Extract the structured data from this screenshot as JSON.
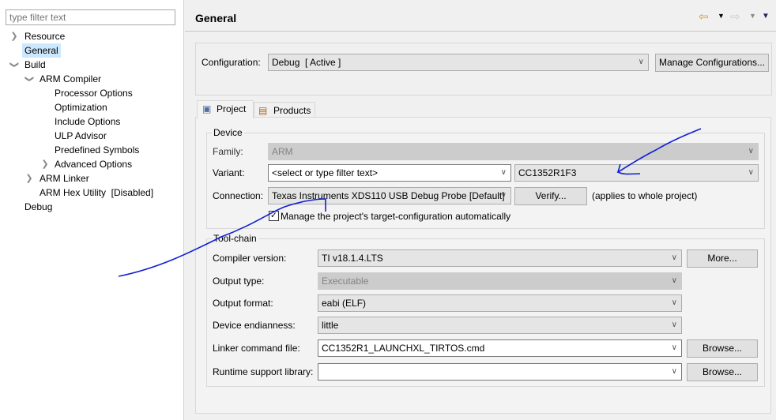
{
  "sidebar": {
    "filter_placeholder": "type filter text",
    "items": [
      {
        "label": "Resource"
      },
      {
        "label": "General"
      },
      {
        "label": "Build"
      },
      {
        "label": "ARM Compiler"
      },
      {
        "label": "Processor Options"
      },
      {
        "label": "Optimization"
      },
      {
        "label": "Include Options"
      },
      {
        "label": "ULP Advisor"
      },
      {
        "label": "Predefined Symbols"
      },
      {
        "label": "Advanced Options"
      },
      {
        "label": "ARM Linker"
      },
      {
        "label": "ARM Hex Utility  [Disabled]"
      },
      {
        "label": "Debug"
      }
    ]
  },
  "header": {
    "title": "General"
  },
  "config": {
    "label": "Configuration:",
    "value": "Debug  [ Active ]",
    "manage": "Manage Configurations..."
  },
  "tabs": [
    {
      "label": "Project"
    },
    {
      "label": "Products"
    }
  ],
  "device": {
    "title": "Device",
    "family_label": "Family:",
    "family": "ARM",
    "variant_label": "Variant:",
    "variant_filter": "<select or type filter text>",
    "variant": "CC1352R1F3",
    "connection_label": "Connection:",
    "connection": "Texas Instruments XDS110 USB Debug Probe [Default]",
    "verify": "Verify...",
    "applies": "(applies to whole project)",
    "manage_label": "Manage the project's target-configuration automatically",
    "manage_checked": true
  },
  "toolchain": {
    "title": "Tool-chain",
    "compiler_label": "Compiler version:",
    "compiler": "TI v18.1.4.LTS",
    "more": "More...",
    "output_type_label": "Output type:",
    "output_type": "Executable",
    "output_format_label": "Output format:",
    "output_format": "eabi (ELF)",
    "endian_label": "Device endianness:",
    "endian": "little",
    "linker_label": "Linker command file:",
    "linker": "CC1352R1_LAUNCHXL_TIRTOS.cmd",
    "browse": "Browse...",
    "runtime_label": "Runtime support library:",
    "runtime": ""
  }
}
